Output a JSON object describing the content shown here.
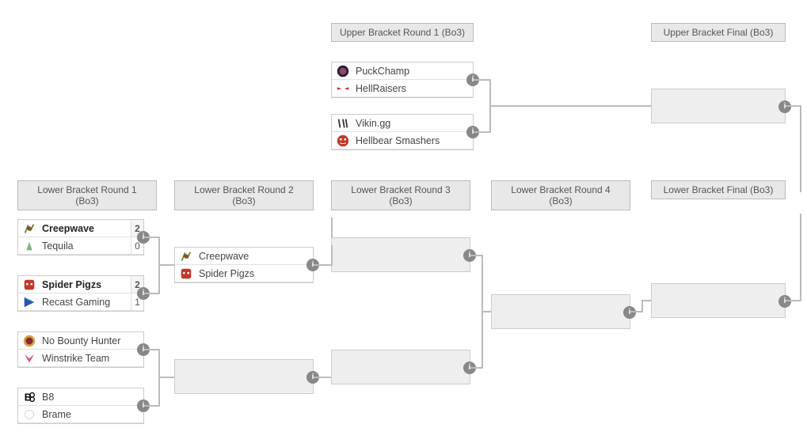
{
  "headers": {
    "ub1": "Upper Bracket Round 1 (Bo3)",
    "ubf": "Upper Bracket Final (Bo3)",
    "lb1": "Lower Bracket Round 1 (Bo3)",
    "lb2": "Lower Bracket Round 2 (Bo3)",
    "lb3": "Lower Bracket Round 3 (Bo3)",
    "lb4": "Lower Bracket Round 4 (Bo3)",
    "lbf": "Lower Bracket Final (Bo3)"
  },
  "ub": {
    "m1": {
      "t1": "PuckChamp",
      "t2": "HellRaisers"
    },
    "m2": {
      "t1": "Vikin.gg",
      "t2": "Hellbear Smashers"
    }
  },
  "lb": {
    "r1m1": {
      "t1": "Creepwave",
      "s1": "2",
      "t2": "Tequila",
      "s2": "0"
    },
    "r1m2": {
      "t1": "Spider Pigzs",
      "s1": "2",
      "t2": "Recast Gaming",
      "s2": "1"
    },
    "r1m3": {
      "t1": "No Bounty Hunter",
      "t2": "Winstrike Team"
    },
    "r1m4": {
      "t1": "B8",
      "t2": "Brame"
    },
    "r2m1": {
      "t1": "Creepwave",
      "t2": "Spider Pigzs"
    }
  },
  "info": "i"
}
